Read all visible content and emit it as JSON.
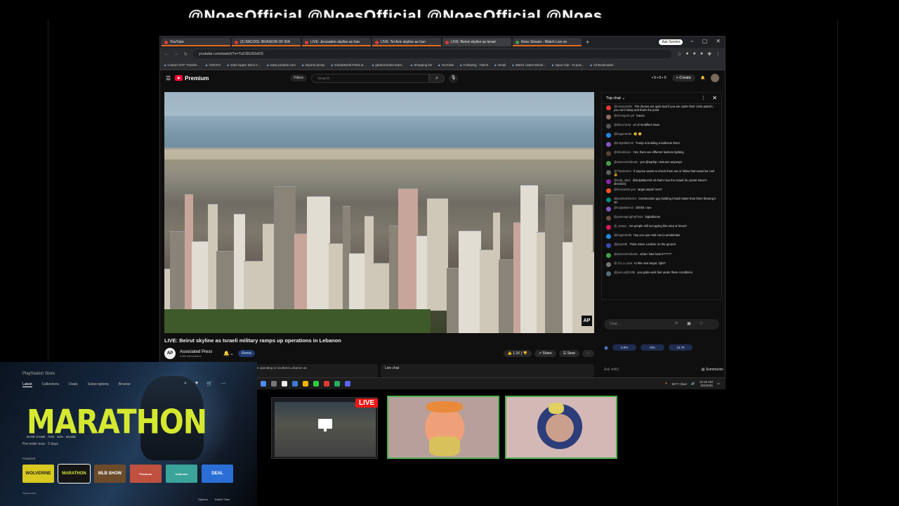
{
  "overlay_banner": "@NoesOfficial @NoesOfficial @NoesOfficial @Noes",
  "browser": {
    "tabs": [
      {
        "label": "YouTube",
        "active": false
      },
      {
        "label": "(2) BACOOL INVASION OF IRA",
        "active": false
      },
      {
        "label": "LIVE: Jerusalem skyline as Iran",
        "active": false
      },
      {
        "label": "LIVE: Tel Aviv skyline as Iran",
        "active": false
      },
      {
        "label": "LIVE: Beirut skyline as Israel",
        "active": true
      },
      {
        "label": "Noes Stream - Watch Live on",
        "active": false
      }
    ],
    "new_tab": "+",
    "ask_gemini": "Ask Gemini",
    "url": "youtube.com/watch?v=YuC8G3DeDS",
    "bookmarks": [
      "Custom DTF Transfe...",
      "VISCOA",
      "2323 Upper Deck C...",
      "www.youtube.com",
      "imports jersey",
      "GarduWorld Parks &...",
      "gardenrealtor.team...",
      "Shopping list",
      "YouTube",
      "Following - Twitch",
      "Gmail",
      "Watch Latest Movie...",
      "Opus Clip - AI-pow...",
      "All Bookmarks"
    ]
  },
  "youtube": {
    "brand": "Premium",
    "filters": "Filters",
    "search_placeholder": "Search",
    "create": "Create",
    "video_title": "LIVE: Beirut skyline as Israeli military ramps up operations in Lebanon",
    "channel_name": "Associated Press",
    "channel_initials": "AP",
    "subscribers": "4.8M subscribers",
    "remix": "Remix",
    "likes": "1.1K",
    "share": "Share",
    "save": "Save",
    "description": "#Beirut #Lebanon #Israel #live  ·  Israel's military said soldiers are operating in southern Lebanon as",
    "live_chat_label": "Live chat",
    "watermark": "AP"
  },
  "chat": {
    "header": "Top chat",
    "messages": [
      {
        "user": "@mesa42304",
        "text": "The drones are quite bad if you are under their circle pattern, you can't sleep and that's the point",
        "color": "#e53935"
      },
      {
        "user": "@Cinnaport-y4l",
        "text": "traces",
        "color": "#8d6e63"
      },
      {
        "user": "@skloo.5134",
        "text": "ez of modifiers.imao",
        "color": "#555"
      },
      {
        "user": "@bcgamer86",
        "text": "😊 😊",
        "color": "#1e88e5"
      },
      {
        "user": "@IndyMikeFoli",
        "text": "Trump is building a ballroom there",
        "color": "#7e57c2"
      },
      {
        "user": "@Sheriboni1",
        "text": "Yes, there are different factions fighting",
        "color": "#5d4037"
      },
      {
        "user": "@dumenohobeatz",
        "text": "yes @ssplop I assume anyways",
        "color": "#43a047"
      },
      {
        "user": "@ThatXterior",
        "text": "If anyone wants to check them out or follow that would be cool 😎",
        "color": "#616161"
      },
      {
        "user": "@sully_slkrs",
        "text": "@IndyMikeFoli ah that's how the Israeli do (under steve's direction)",
        "color": "#8e24aa"
      },
      {
        "user": "@Duncaster.yes",
        "text": "target airport next?",
        "color": "#f4511e"
      },
      {
        "user": "@josefswhite244",
        "text": "Construction guy building it back faster than them blowing it up..",
        "color": "#00897b"
      },
      {
        "user": "@IndyMikeFoli",
        "text": "Ohhhh I see",
        "color": "#7e57c2"
      },
      {
        "user": "@pietrosprugforti7623",
        "text": "bigballroom",
        "color": "#6d4c41"
      },
      {
        "user": "@_Easy1",
        "text": "Are people still occupying this area or know?",
        "color": "#d81b60"
      },
      {
        "user": "@bcgamer86",
        "text": "hay uno que está con la amaluhdas",
        "color": "#1e88e5"
      },
      {
        "user": "@jhpa295",
        "text": "Thats Steve Lookner on the ground",
        "color": "#3949ab"
      },
      {
        "user": "@dumenohobeatz",
        "text": "what I hate hate it?????",
        "color": "#43a047"
      },
      {
        "user": "@ゴルムルDa",
        "text": "Is this next target, right?",
        "color": "#757575"
      },
      {
        "user": "@purcus@1305",
        "text": "you gotta work fast under these conditions",
        "color": "#546e7a"
      }
    ],
    "input_placeholder": "Chat...",
    "stats": [
      "0.6%",
      "N/A",
      "15.7K"
    ],
    "ask": "Ask vidIQ",
    "summarize": "Summarize"
  },
  "taskbar": {
    "weather": "59°F  Clear",
    "time": "12:15 AM",
    "date": "3/4/2026"
  },
  "ps5": {
    "store_title": "PlayStation Store",
    "nav": [
      "Latest",
      "Collections",
      "Deals",
      "Subscriptions",
      "Browse"
    ],
    "game_logo": "MARATHON",
    "game_sub": "BASE GAME   ·   PS5   ·   40%   ·   Bundle",
    "preorder_text": "Pre-order now · 2 days",
    "section": "Featured",
    "tiles": [
      "WOLVERINE",
      "MARATHON",
      "MLB SHOW",
      "Pokemon",
      "Unknown",
      "DEAL"
    ],
    "footer": "Sponsored",
    "footer_actions": [
      "Options",
      "Switch Tabs"
    ]
  },
  "stream": {
    "live_label": "LIVE"
  }
}
